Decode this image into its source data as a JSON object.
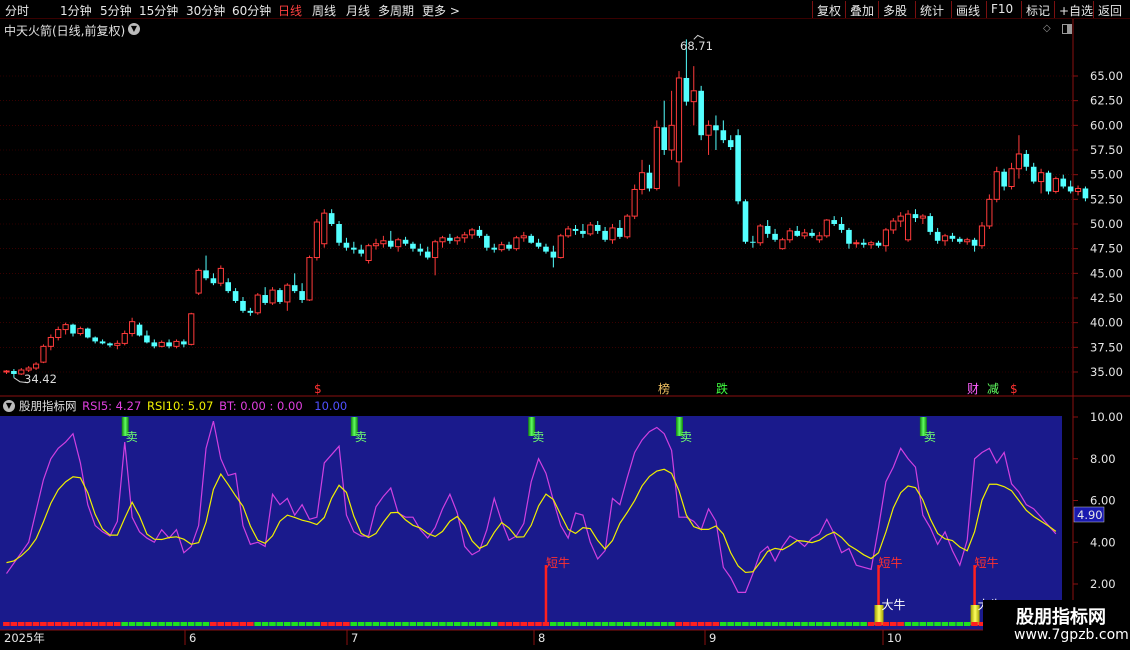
{
  "toolbar": {
    "periods": [
      "分时",
      "1分钟",
      "5分钟",
      "15分钟",
      "30分钟",
      "60分钟",
      "日线",
      "周线",
      "月线",
      "多周期",
      "更多 >"
    ],
    "active_period": "日线",
    "tools": [
      "复权",
      "叠加",
      "多股",
      "统计",
      "画线",
      "F10",
      "标记",
      "+自选",
      "返回"
    ]
  },
  "stock": {
    "title": "中天火箭(日线,前复权)"
  },
  "indicator": {
    "name": "股朋指标网",
    "rsi5_label": "RSI5: 4.27",
    "rsi10_label": "RSI10: 5.07",
    "bt_label": "BT: 0.00 : 0.00",
    "level_label": "10.00",
    "current_value": "4.90",
    "colors": {
      "rsi5": "#d040e0",
      "rsi10": "#f0f000",
      "bg": "#1a1a8c"
    }
  },
  "price_axis": {
    "ticks": [
      "65.00",
      "62.50",
      "60.00",
      "57.50",
      "55.00",
      "52.50",
      "50.00",
      "47.50",
      "45.00",
      "42.50",
      "40.00",
      "37.50",
      "35.00"
    ]
  },
  "ind_axis": {
    "ticks": [
      "10.00",
      "8.00",
      "6.00",
      "4.00",
      "2.00"
    ]
  },
  "date_axis": {
    "labels": [
      "2025年",
      "6",
      "7",
      "8",
      "9",
      "10"
    ]
  },
  "annotations": {
    "high": "68.71",
    "low": "34.42",
    "signal_s": "$",
    "signal_rank": "榜",
    "signal_fall": "跌",
    "signal_finance": "财",
    "signal_reduce": "减",
    "sell": "卖",
    "short_bull": "短牛",
    "big_bull": "大牛"
  },
  "watermark": {
    "title": "股朋指标网",
    "url": "www.7gpzb.com"
  },
  "chart_data": {
    "type": "candlestick",
    "candles": [
      [
        35.0,
        35.2,
        34.8,
        35.1
      ],
      [
        35.1,
        35.3,
        34.42,
        34.8
      ],
      [
        34.8,
        35.4,
        34.7,
        35.2
      ],
      [
        35.2,
        35.6,
        35.0,
        35.4
      ],
      [
        35.4,
        36.0,
        35.2,
        35.8
      ],
      [
        36.0,
        37.8,
        35.9,
        37.6
      ],
      [
        37.6,
        38.8,
        37.2,
        38.5
      ],
      [
        38.5,
        39.6,
        38.2,
        39.3
      ],
      [
        39.3,
        40.0,
        38.8,
        39.8
      ],
      [
        39.8,
        39.9,
        38.6,
        38.9
      ],
      [
        38.9,
        39.6,
        38.7,
        39.4
      ],
      [
        39.4,
        39.5,
        38.4,
        38.5
      ],
      [
        38.5,
        38.6,
        37.9,
        38.1
      ],
      [
        38.1,
        38.3,
        37.8,
        37.9
      ],
      [
        37.9,
        38.0,
        37.5,
        37.7
      ],
      [
        37.7,
        38.2,
        37.3,
        37.9
      ],
      [
        37.9,
        39.2,
        37.7,
        38.9
      ],
      [
        38.9,
        40.5,
        38.6,
        40.1
      ],
      [
        39.8,
        40.0,
        38.6,
        38.7
      ],
      [
        38.7,
        39.2,
        37.9,
        38.0
      ],
      [
        38.0,
        38.3,
        37.4,
        37.6
      ],
      [
        37.6,
        38.2,
        37.5,
        38.0
      ],
      [
        38.0,
        38.3,
        37.4,
        37.6
      ],
      [
        37.6,
        38.3,
        37.4,
        38.1
      ],
      [
        38.1,
        38.3,
        37.5,
        37.8
      ],
      [
        37.8,
        41.0,
        37.7,
        40.9
      ],
      [
        43.0,
        45.5,
        42.8,
        45.3
      ],
      [
        45.3,
        46.8,
        44.3,
        44.5
      ],
      [
        44.5,
        45.0,
        43.8,
        44.0
      ],
      [
        44.0,
        45.8,
        43.7,
        45.5
      ],
      [
        44.1,
        44.5,
        43.0,
        43.2
      ],
      [
        43.2,
        43.5,
        42.0,
        42.2
      ],
      [
        42.2,
        42.6,
        41.0,
        41.2
      ],
      [
        41.2,
        41.5,
        40.7,
        41.0
      ],
      [
        41.0,
        43.0,
        40.8,
        42.8
      ],
      [
        42.8,
        43.6,
        41.8,
        42.0
      ],
      [
        42.0,
        43.6,
        41.8,
        43.3
      ],
      [
        43.3,
        43.5,
        41.9,
        42.1
      ],
      [
        42.1,
        44.0,
        41.2,
        43.8
      ],
      [
        43.8,
        45.0,
        43.0,
        43.2
      ],
      [
        43.2,
        44.0,
        42.0,
        42.3
      ],
      [
        42.3,
        46.8,
        42.2,
        46.6
      ],
      [
        46.6,
        50.5,
        46.3,
        50.2
      ],
      [
        48.0,
        51.5,
        47.6,
        51.1
      ],
      [
        51.1,
        51.5,
        49.8,
        50.0
      ],
      [
        50.0,
        50.3,
        47.8,
        48.1
      ],
      [
        48.1,
        48.6,
        47.3,
        47.6
      ],
      [
        47.6,
        48.2,
        47.0,
        47.4
      ],
      [
        47.4,
        47.9,
        46.7,
        47.0
      ],
      [
        46.3,
        48.0,
        46.0,
        47.8
      ],
      [
        47.8,
        48.5,
        47.4,
        48.0
      ],
      [
        48.0,
        48.8,
        47.6,
        48.3
      ],
      [
        48.3,
        49.3,
        47.5,
        47.7
      ],
      [
        47.7,
        48.6,
        47.2,
        48.4
      ],
      [
        48.4,
        48.7,
        47.8,
        48.0
      ],
      [
        48.0,
        48.2,
        47.2,
        47.5
      ],
      [
        47.5,
        48.0,
        46.8,
        47.2
      ],
      [
        47.2,
        47.7,
        46.4,
        46.6
      ],
      [
        46.6,
        48.4,
        44.8,
        48.2
      ],
      [
        48.2,
        48.8,
        47.6,
        48.6
      ],
      [
        48.6,
        49.0,
        48.0,
        48.3
      ],
      [
        48.3,
        48.8,
        47.9,
        48.6
      ],
      [
        48.6,
        49.2,
        48.1,
        48.9
      ],
      [
        48.9,
        49.6,
        48.5,
        49.4
      ],
      [
        49.4,
        49.8,
        48.6,
        48.8
      ],
      [
        48.8,
        49.0,
        47.3,
        47.6
      ],
      [
        47.6,
        48.0,
        47.1,
        47.4
      ],
      [
        47.4,
        48.2,
        47.2,
        47.9
      ],
      [
        47.9,
        48.2,
        47.3,
        47.5
      ],
      [
        47.5,
        48.8,
        47.3,
        48.6
      ],
      [
        48.6,
        49.2,
        48.2,
        48.8
      ],
      [
        48.8,
        49.0,
        48.0,
        48.1
      ],
      [
        48.1,
        48.5,
        47.5,
        47.7
      ],
      [
        47.7,
        48.0,
        47.0,
        47.2
      ],
      [
        47.2,
        47.8,
        45.6,
        46.6
      ],
      [
        46.6,
        49.0,
        46.5,
        48.8
      ],
      [
        48.8,
        49.8,
        48.6,
        49.5
      ],
      [
        49.5,
        49.9,
        48.9,
        49.3
      ],
      [
        49.3,
        50.0,
        48.6,
        49.0
      ],
      [
        49.0,
        50.2,
        48.8,
        49.9
      ],
      [
        49.9,
        50.3,
        49.0,
        49.3
      ],
      [
        49.3,
        49.7,
        48.2,
        48.4
      ],
      [
        48.4,
        50.0,
        48.0,
        49.6
      ],
      [
        49.6,
        50.4,
        48.5,
        48.7
      ],
      [
        48.7,
        51.0,
        48.5,
        50.8
      ],
      [
        50.8,
        54.0,
        50.5,
        53.5
      ],
      [
        53.5,
        56.5,
        53.0,
        55.2
      ],
      [
        55.2,
        56.0,
        53.3,
        53.6
      ],
      [
        53.6,
        60.5,
        53.4,
        59.8
      ],
      [
        59.8,
        62.5,
        57.0,
        57.5
      ],
      [
        57.5,
        63.5,
        56.5,
        60.0
      ],
      [
        56.3,
        65.5,
        53.8,
        64.8
      ],
      [
        64.8,
        68.71,
        62.0,
        62.4
      ],
      [
        62.4,
        66.0,
        60.0,
        63.5
      ],
      [
        63.5,
        64.0,
        58.5,
        59.0
      ],
      [
        59.0,
        60.5,
        57.0,
        60.0
      ],
      [
        60.0,
        61.0,
        57.5,
        59.5
      ],
      [
        59.5,
        60.5,
        58.2,
        58.5
      ],
      [
        58.5,
        59.0,
        57.5,
        57.8
      ],
      [
        59.0,
        59.6,
        52.0,
        52.3
      ],
      [
        52.3,
        52.5,
        48.0,
        48.2
      ],
      [
        48.2,
        48.8,
        47.6,
        48.1
      ],
      [
        48.1,
        50.0,
        47.8,
        49.8
      ],
      [
        49.8,
        50.4,
        48.6,
        49.0
      ],
      [
        49.0,
        49.5,
        48.2,
        48.4
      ],
      [
        47.5,
        48.6,
        47.4,
        48.4
      ],
      [
        48.4,
        49.6,
        48.1,
        49.3
      ],
      [
        49.3,
        49.8,
        48.7,
        48.8
      ],
      [
        48.8,
        49.5,
        48.5,
        49.1
      ],
      [
        49.1,
        49.5,
        48.6,
        48.8
      ],
      [
        48.4,
        49.2,
        48.1,
        48.8
      ],
      [
        48.8,
        50.5,
        48.6,
        50.4
      ],
      [
        50.4,
        50.8,
        49.8,
        50.0
      ],
      [
        50.0,
        50.7,
        49.1,
        49.4
      ],
      [
        49.4,
        49.6,
        47.5,
        48.0
      ],
      [
        48.0,
        48.4,
        47.6,
        48.1
      ],
      [
        48.1,
        48.5,
        47.6,
        47.9
      ],
      [
        47.9,
        48.3,
        47.5,
        48.1
      ],
      [
        48.1,
        48.3,
        47.6,
        47.8
      ],
      [
        47.8,
        49.6,
        47.2,
        49.4
      ],
      [
        49.4,
        50.6,
        49.0,
        50.3
      ],
      [
        50.3,
        51.2,
        49.7,
        50.8
      ],
      [
        48.4,
        51.4,
        48.2,
        51.0
      ],
      [
        51.0,
        51.5,
        50.2,
        50.6
      ],
      [
        50.6,
        51.0,
        50.0,
        50.8
      ],
      [
        50.8,
        51.1,
        48.9,
        49.2
      ],
      [
        49.2,
        49.6,
        48.0,
        48.3
      ],
      [
        48.3,
        49.0,
        47.8,
        48.8
      ],
      [
        48.8,
        49.1,
        48.2,
        48.5
      ],
      [
        48.5,
        48.7,
        48.0,
        48.2
      ],
      [
        48.2,
        48.6,
        47.9,
        48.4
      ],
      [
        48.4,
        48.6,
        47.2,
        47.8
      ],
      [
        47.8,
        50.2,
        47.5,
        49.8
      ],
      [
        49.8,
        53.0,
        49.5,
        52.5
      ],
      [
        52.5,
        55.8,
        52.2,
        55.3
      ],
      [
        55.3,
        55.6,
        53.4,
        53.8
      ],
      [
        53.8,
        56.2,
        53.5,
        55.6
      ],
      [
        55.6,
        59.0,
        54.6,
        57.1
      ],
      [
        57.1,
        57.5,
        55.4,
        55.8
      ],
      [
        55.8,
        56.2,
        54.1,
        54.3
      ],
      [
        54.3,
        55.6,
        53.1,
        55.2
      ],
      [
        55.2,
        55.4,
        53.0,
        53.3
      ],
      [
        53.3,
        54.8,
        53.1,
        54.6
      ],
      [
        54.6,
        55.0,
        53.6,
        53.8
      ],
      [
        53.8,
        54.4,
        53.1,
        53.3
      ],
      [
        53.3,
        53.9,
        52.9,
        53.6
      ],
      [
        53.6,
        53.8,
        52.3,
        52.6
      ]
    ],
    "rsi5": [
      2.5,
      3.0,
      3.5,
      4.0,
      5.5,
      7.0,
      8.0,
      8.5,
      8.8,
      9.2,
      7.8,
      5.8,
      4.8,
      4.5,
      4.3,
      5.0,
      8.8,
      5.2,
      4.5,
      4.2,
      4.0,
      4.6,
      4.2,
      4.6,
      3.5,
      3.8,
      4.8,
      8.5,
      9.8,
      8.0,
      7.2,
      7.3,
      4.8,
      3.9,
      4.0,
      3.8,
      6.3,
      5.8,
      6.1,
      5.3,
      5.8,
      5.1,
      5.2,
      7.8,
      8.2,
      8.6,
      5.3,
      4.5,
      4.3,
      4.3,
      5.7,
      6.2,
      6.6,
      5.4,
      5.2,
      5.2,
      4.6,
      4.2,
      4.7,
      5.6,
      6.3,
      5.4,
      3.8,
      3.4,
      3.6,
      4.6,
      6.1,
      5.0,
      4.1,
      4.3,
      4.9,
      6.9,
      8.0,
      7.3,
      6.0,
      4.8,
      4.2,
      5.4,
      5.3,
      4.0,
      3.2,
      3.6,
      6.1,
      5.8,
      7.1,
      8.3,
      8.9,
      9.3,
      9.5,
      9.2,
      8.4,
      5.2,
      5.2,
      5.0,
      4.6,
      5.6,
      5.0,
      2.8,
      2.3,
      1.6,
      1.6,
      2.5,
      3.5,
      3.8,
      3.1,
      3.8,
      4.3,
      4.1,
      3.8,
      4.2,
      4.4,
      5.1,
      4.4,
      3.5,
      3.7,
      2.9,
      2.8,
      2.7,
      4.7,
      6.9,
      7.6,
      8.5,
      8.0,
      7.6,
      5.3,
      4.7,
      3.9,
      4.5,
      3.6,
      2.9,
      4.1,
      8.0,
      8.3,
      8.5,
      7.8,
      8.3,
      6.8,
      6.4,
      5.8,
      5.6,
      5.2,
      4.8,
      4.4
    ]
  }
}
